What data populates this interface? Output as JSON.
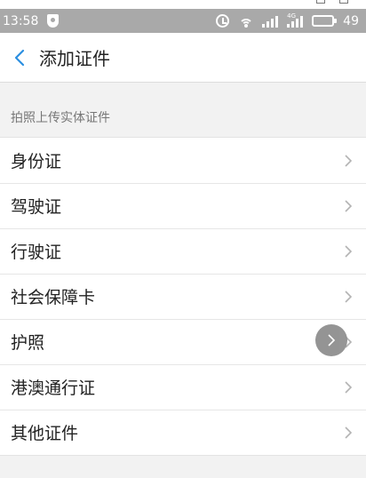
{
  "status_bar": {
    "time": "13:58",
    "battery_text": "49",
    "battery_level": 0.49,
    "network_tag": "4G"
  },
  "header": {
    "title": "添加证件"
  },
  "section": {
    "title": "拍照上传实体证件"
  },
  "items": [
    {
      "label": "身份证"
    },
    {
      "label": "驾驶证"
    },
    {
      "label": "行驶证"
    },
    {
      "label": "社会保障卡"
    },
    {
      "label": "护照"
    },
    {
      "label": "港澳通行证"
    },
    {
      "label": "其他证件"
    }
  ],
  "colors": {
    "status_bar": "#a9a9a9",
    "accent": "#2b8fe0",
    "chevron": "#b3b3b3"
  }
}
